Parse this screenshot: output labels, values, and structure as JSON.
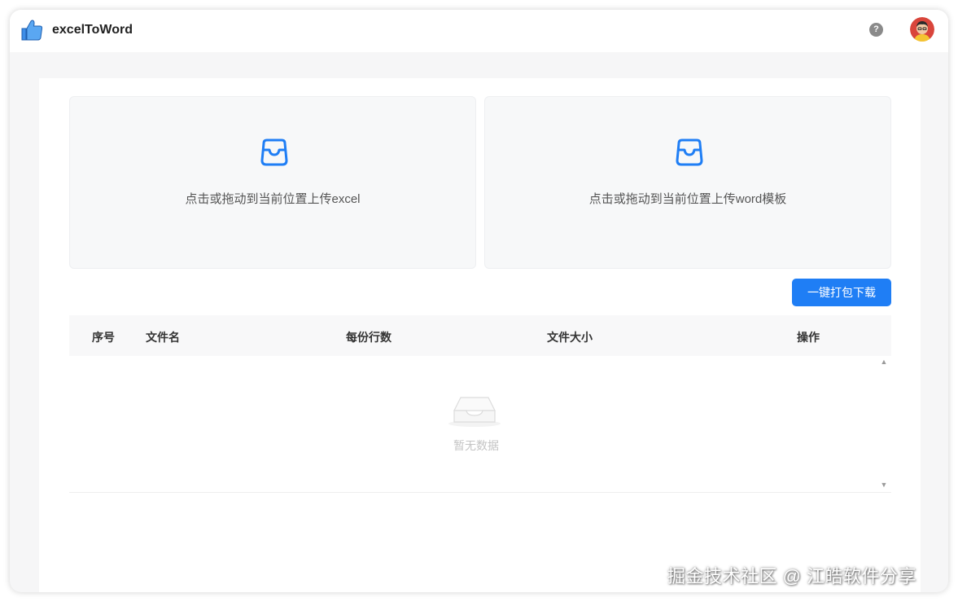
{
  "app": {
    "title": "excelToWord",
    "accent_color": "#1f7ef5"
  },
  "header": {
    "help_icon": "question-circle-icon",
    "help_glyph": "?",
    "avatar_icon": "user-avatar"
  },
  "upload": {
    "excel_text": "点击或拖动到当前位置上传excel",
    "word_text": "点击或拖动到当前位置上传word模板",
    "icon": "inbox-icon"
  },
  "toolbar": {
    "download_label": "一键打包下载"
  },
  "table": {
    "columns": [
      "序号",
      "文件名",
      "每份行数",
      "文件大小",
      "操作"
    ],
    "rows": [],
    "empty_text": "暂无数据",
    "scroll_up_glyph": "▲",
    "scroll_down_glyph": "▼"
  },
  "watermark": {
    "text": "掘金技术社区 @ 江皓软件分享"
  }
}
